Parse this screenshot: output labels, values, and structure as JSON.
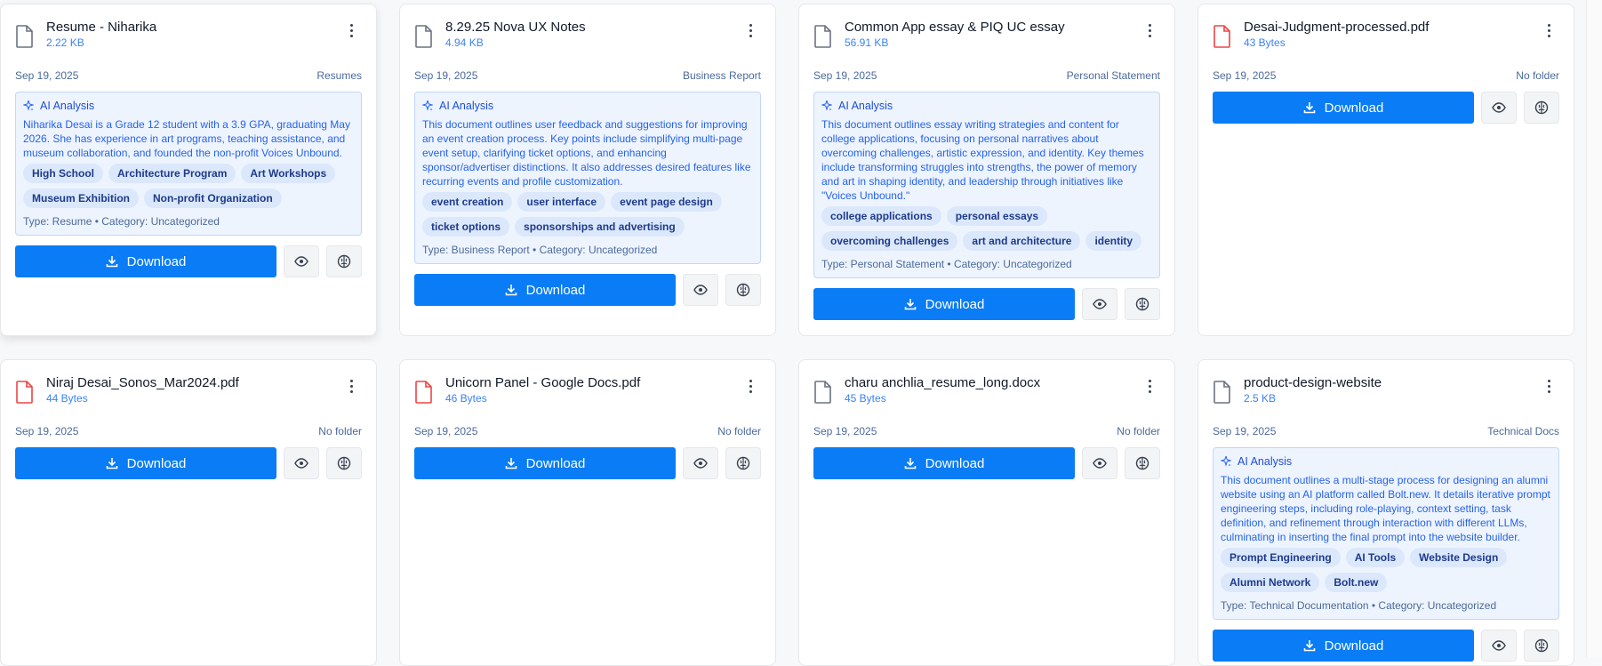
{
  "files": [
    {
      "name": "Resume - Niharika",
      "size": "2.22 KB",
      "date": "Sep 19, 2025",
      "folder": "Resumes",
      "icon": "file-icon",
      "ai": {
        "heading": "AI Analysis",
        "summary": "Niharika Desai is a Grade 12 student with a 3.9 GPA, graduating May 2026. She has experience in art programs, teaching assistance, and museum collaboration, and founded the non-profit Voices Unbound.",
        "tags": [
          "High School",
          "Architecture Program",
          "Art Workshops",
          "Museum Exhibition",
          "Non-profit Organization"
        ],
        "type_line": "Type: Resume • Category: Uncategorized"
      },
      "download_label": "Download"
    },
    {
      "name": "8.29.25 Nova UX Notes",
      "size": "4.94 KB",
      "date": "Sep 19, 2025",
      "folder": "Business Report",
      "icon": "file-icon",
      "ai": {
        "heading": "AI Analysis",
        "summary": "This document outlines user feedback and suggestions for improving an event creation process. Key points include simplifying multi-page event setup, clarifying ticket options, and enhancing sponsor/advertiser distinctions. It also addresses desired features like recurring events and profile customization.",
        "tags": [
          "event creation",
          "user interface",
          "event page design",
          "ticket options",
          "sponsorships and advertising"
        ],
        "type_line": "Type: Business Report • Category: Uncategorized"
      },
      "download_label": "Download"
    },
    {
      "name": "Common App essay & PIQ UC essay",
      "size": "56.91 KB",
      "date": "Sep 19, 2025",
      "folder": "Personal Statement",
      "icon": "file-icon",
      "ai": {
        "heading": "AI Analysis",
        "summary": "This document outlines essay writing strategies and content for college applications, focusing on personal narratives about overcoming challenges, artistic expression, and identity. Key themes include transforming struggles into strengths, the power of memory and art in shaping identity, and leadership through initiatives like \"Voices Unbound.\"",
        "tags": [
          "college applications",
          "personal essays",
          "overcoming challenges",
          "art and architecture",
          "identity"
        ],
        "type_line": "Type: Personal Statement • Category: Uncategorized"
      },
      "download_label": "Download"
    },
    {
      "name": "Desai-Judgment-processed.pdf",
      "size": "43 Bytes",
      "date": "Sep 19, 2025",
      "folder": "No folder",
      "icon": "pdf-file-icon",
      "download_label": "Download"
    },
    {
      "name": "Niraj Desai_Sonos_Mar2024.pdf",
      "size": "44 Bytes",
      "date": "Sep 19, 2025",
      "folder": "No folder",
      "icon": "pdf-file-icon",
      "download_label": "Download"
    },
    {
      "name": "Unicorn Panel - Google Docs.pdf",
      "size": "46 Bytes",
      "date": "Sep 19, 2025",
      "folder": "No folder",
      "icon": "pdf-file-icon",
      "download_label": "Download"
    },
    {
      "name": "charu anchlia_resume_long.docx",
      "size": "45 Bytes",
      "date": "Sep 19, 2025",
      "folder": "No folder",
      "icon": "file-icon",
      "download_label": "Download"
    },
    {
      "name": "product-design-website",
      "size": "2.5 KB",
      "date": "Sep 19, 2025",
      "folder": "Technical Docs",
      "icon": "file-icon",
      "ai": {
        "heading": "AI Analysis",
        "summary": "This document outlines a multi-stage process for designing an alumni website using an AI platform called Bolt.new. It details iterative prompt engineering steps, including role-playing, context setting, task definition, and refinement through interaction with different LLMs, culminating in inserting the final prompt into the website builder.",
        "tags": [
          "Prompt Engineering",
          "AI Tools",
          "Website Design",
          "Alumni Network",
          "Bolt.new"
        ],
        "type_line": "Type: Technical Documentation • Category: Uncategorized"
      },
      "download_label": "Download"
    }
  ],
  "colors": {
    "primary": "#0a7cf5",
    "pdf_icon": "#ef4444",
    "doc_icon": "#6b7280",
    "ai_bg": "#eef4fe",
    "tag_bg": "#dbe8fb"
  }
}
